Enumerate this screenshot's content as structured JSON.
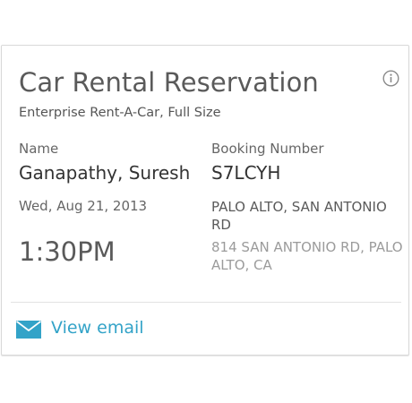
{
  "card": {
    "title": "Car Rental Reservation",
    "subtitle": "Enterprise Rent-A-Car, Full Size",
    "info_icon": "info-circle-icon",
    "name_label": "Name",
    "name_value": "Ganapathy, Suresh",
    "booking_label": "Booking Number",
    "booking_value": "S7LCYH",
    "date": "Wed, Aug 21, 2013",
    "time": "1:30PM",
    "location": "PALO ALTO, SAN ANTONIO RD",
    "address": "814 SAN ANTONIO RD, PALO ALTO, CA",
    "action_label": "View email",
    "action_icon": "envelope-icon"
  },
  "colors": {
    "accent": "#33a3c8",
    "title_text": "#5a5a5a",
    "secondary_text": "#9b9b9b"
  }
}
